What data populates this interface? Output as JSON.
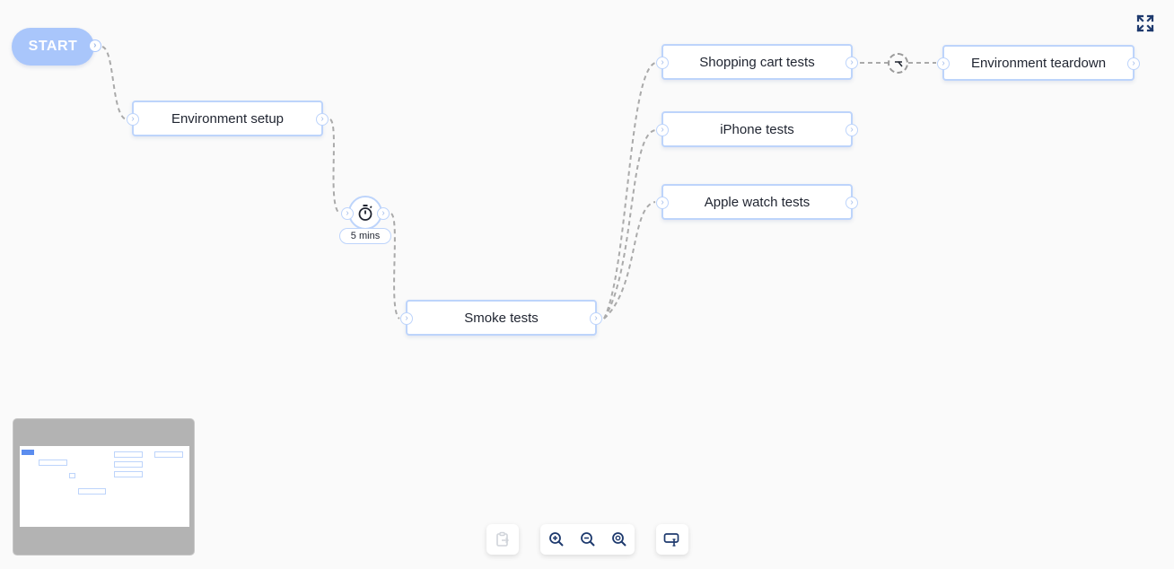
{
  "start": {
    "label": "START"
  },
  "nodes": {
    "environment_setup": "Environment setup",
    "smoke_tests": "Smoke tests",
    "shopping_cart_tests": "Shopping cart tests",
    "iphone_tests": "iPhone tests",
    "apple_watch_tests": "Apple watch tests",
    "environment_teardown": "Environment teardown"
  },
  "timer": {
    "label": "5 mins",
    "icon": "stopwatch-icon"
  },
  "condition": {
    "icon": "branch-condition-icon"
  },
  "icons": {
    "port": "chevron-right-icon",
    "fullscreen": "fullscreen-icon",
    "paste": "paste-icon",
    "zoom_in": "zoom-in-icon",
    "zoom_out": "zoom-out-icon",
    "zoom_fit": "zoom-fit-icon",
    "comment": "comment-icon"
  },
  "colors": {
    "accent": "#a9c6fb",
    "node_border": "#bdd4fb",
    "edge": "#aaaaaa",
    "icon": "#1e3a6e",
    "background": "#fafafa"
  }
}
